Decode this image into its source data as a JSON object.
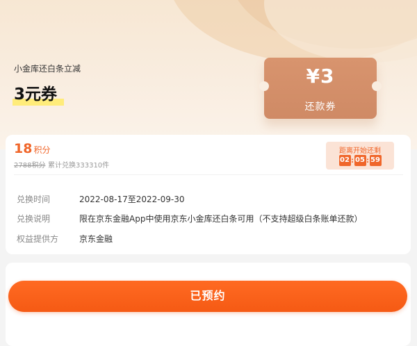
{
  "hero": {
    "subtitle": "小金库还白条立减",
    "title": "3元券"
  },
  "ticket": {
    "amount": "¥3",
    "label": "还款券"
  },
  "points": {
    "value": "18",
    "unit": "积分",
    "original": "2788积分",
    "redeemed_count": "累计兑换333310件"
  },
  "countdown": {
    "label": "距离开始还剩",
    "hours": "02",
    "minutes": "05",
    "seconds": "59"
  },
  "details": [
    {
      "key": "兑换时间",
      "value": "2022-08-17至2022-09-30"
    },
    {
      "key": "兑换说明",
      "value": "限在京东金融App中使用京东小金库还白条可用（不支持超级白条账单还款）"
    },
    {
      "key": "权益提供方",
      "value": "京东金融"
    }
  ],
  "cta": {
    "label": "已预约"
  },
  "colors": {
    "accent": "#f0662a",
    "ticket": "#d8946e",
    "highlight": "#ffec7a"
  }
}
